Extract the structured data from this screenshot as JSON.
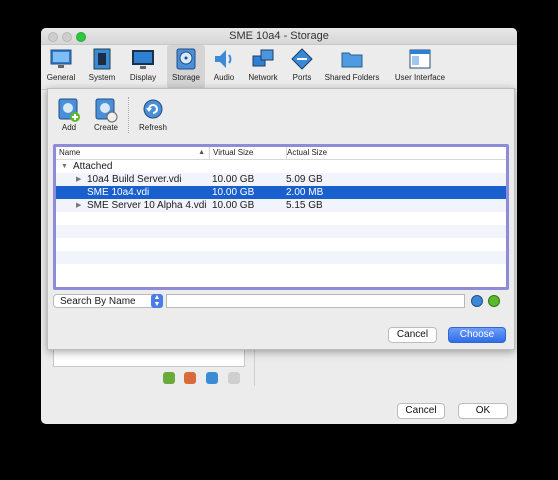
{
  "window": {
    "title": "SME 10a4 - Storage"
  },
  "toolbar": {
    "items": [
      {
        "label": "General",
        "icon": "monitor-general-icon"
      },
      {
        "label": "System",
        "icon": "chip-icon"
      },
      {
        "label": "Display",
        "icon": "display-icon"
      },
      {
        "label": "Storage",
        "icon": "storage-disk-icon",
        "active": true
      },
      {
        "label": "Audio",
        "icon": "speaker-icon"
      },
      {
        "label": "Network",
        "icon": "network-icon"
      },
      {
        "label": "Ports",
        "icon": "ports-icon"
      },
      {
        "label": "Shared Folders",
        "icon": "folder-icon"
      },
      {
        "label": "User Interface",
        "icon": "window-ui-icon"
      }
    ]
  },
  "sheet": {
    "tools": [
      {
        "label": "Add",
        "icon": "add-disk-icon"
      },
      {
        "label": "Create",
        "icon": "create-disk-icon"
      },
      {
        "label": "Refresh",
        "icon": "refresh-icon"
      }
    ],
    "table": {
      "columns": [
        "Name",
        "Virtual Size",
        "Actual Size"
      ],
      "group": "Attached",
      "rows": [
        {
          "name": "10a4 Build Server.vdi",
          "virtual": "10.00 GB",
          "actual": "5.09 GB",
          "expandable": true,
          "selected": false
        },
        {
          "name": "SME 10a4.vdi",
          "virtual": "10.00 GB",
          "actual": "2.00 MB",
          "expandable": false,
          "selected": true
        },
        {
          "name": "SME Server 10 Alpha 4.vdi",
          "virtual": "10.00 GB",
          "actual": "5.15 GB",
          "expandable": true,
          "selected": false
        }
      ]
    },
    "search": {
      "mode": "Search By Name",
      "value": ""
    },
    "cancel_label": "Cancel",
    "choose_label": "Choose"
  },
  "main": {
    "cancel_label": "Cancel",
    "ok_label": "OK"
  },
  "colors": {
    "selection": "#1a5fce",
    "focus_ring": "#8e8cd8",
    "default_button": "#2f6de6"
  }
}
